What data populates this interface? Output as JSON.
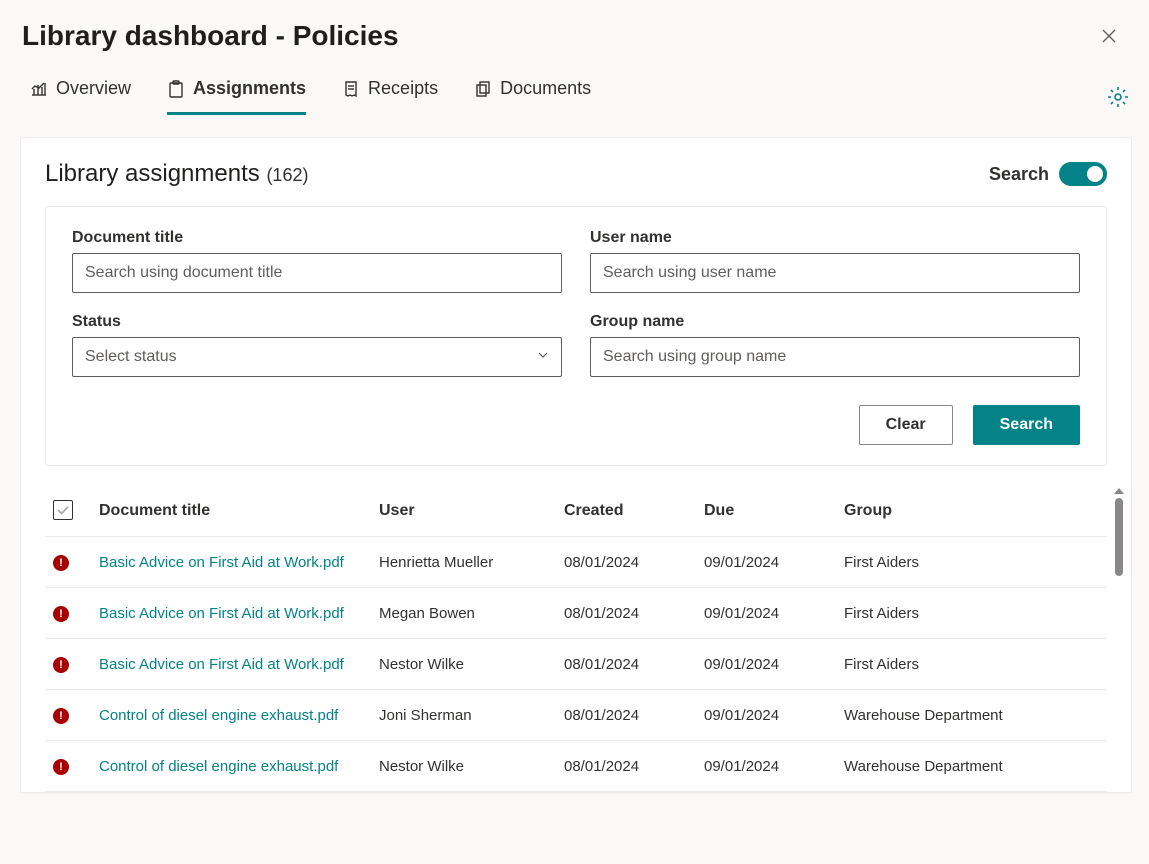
{
  "header": {
    "title": "Library dashboard - Policies"
  },
  "tabs": [
    {
      "label": "Overview",
      "icon": "bar-chart"
    },
    {
      "label": "Assignments",
      "icon": "clipboard",
      "active": true
    },
    {
      "label": "Receipts",
      "icon": "receipt"
    },
    {
      "label": "Documents",
      "icon": "stack"
    }
  ],
  "panel": {
    "title": "Library assignments",
    "count_text": "(162)",
    "search_toggle_label": "Search",
    "search_toggle_on": true
  },
  "filters": {
    "document_title": {
      "label": "Document title",
      "placeholder": "Search using document title",
      "value": ""
    },
    "user_name": {
      "label": "User name",
      "placeholder": "Search using user name",
      "value": ""
    },
    "status": {
      "label": "Status",
      "placeholder": "Select status",
      "value": ""
    },
    "group_name": {
      "label": "Group name",
      "placeholder": "Search using group name",
      "value": ""
    },
    "clear_button": "Clear",
    "search_button": "Search"
  },
  "columns": {
    "document_title": "Document title",
    "user": "User",
    "created": "Created",
    "due": "Due",
    "group": "Group"
  },
  "rows": [
    {
      "status": "overdue",
      "document": "Basic Advice on First Aid at Work.pdf",
      "user": "Henrietta Mueller",
      "created": "08/01/2024",
      "due": "09/01/2024",
      "group": "First Aiders"
    },
    {
      "status": "overdue",
      "document": "Basic Advice on First Aid at Work.pdf",
      "user": "Megan Bowen",
      "created": "08/01/2024",
      "due": "09/01/2024",
      "group": "First Aiders"
    },
    {
      "status": "overdue",
      "document": "Basic Advice on First Aid at Work.pdf",
      "user": "Nestor Wilke",
      "created": "08/01/2024",
      "due": "09/01/2024",
      "group": "First Aiders"
    },
    {
      "status": "overdue",
      "document": "Control of diesel engine exhaust.pdf",
      "user": "Joni Sherman",
      "created": "08/01/2024",
      "due": "09/01/2024",
      "group": "Warehouse Department"
    },
    {
      "status": "overdue",
      "document": "Control of diesel engine exhaust.pdf",
      "user": "Nestor Wilke",
      "created": "08/01/2024",
      "due": "09/01/2024",
      "group": "Warehouse Department"
    }
  ]
}
